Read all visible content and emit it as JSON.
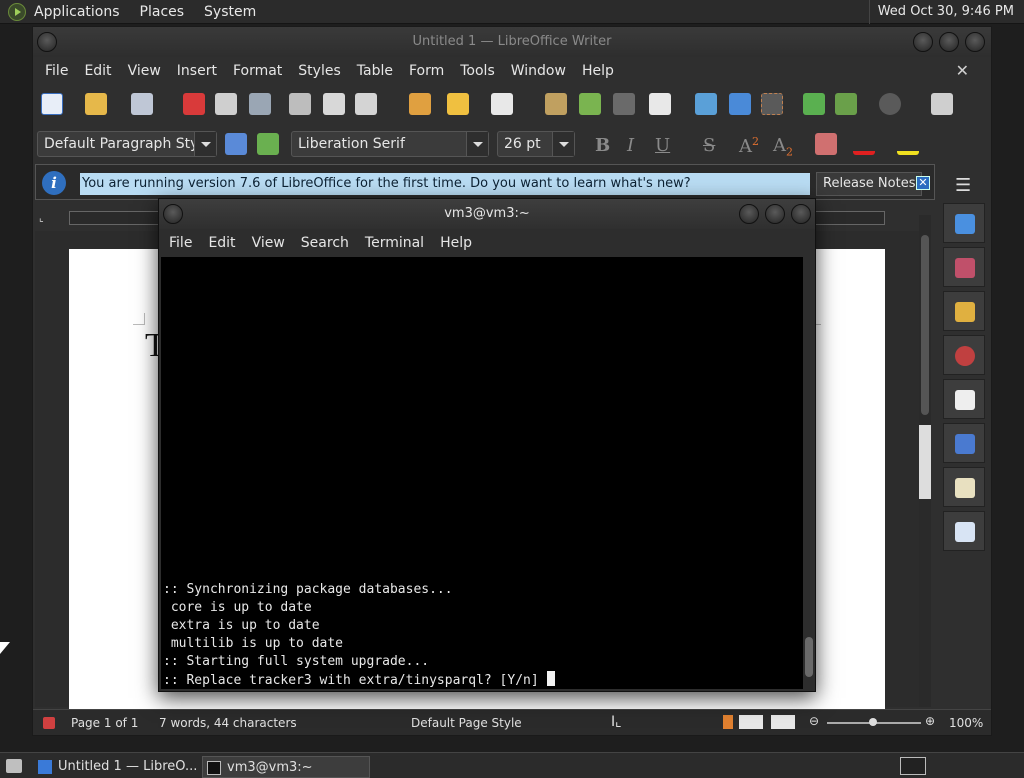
{
  "top_panel": {
    "menus": [
      "Applications",
      "Places",
      "System"
    ],
    "clock": "Wed Oct 30,  9:46 PM"
  },
  "writer": {
    "title": "Untitled 1 — LibreOffice Writer",
    "menu": [
      "File",
      "Edit",
      "View",
      "Insert",
      "Format",
      "Styles",
      "Table",
      "Form",
      "Tools",
      "Window",
      "Help"
    ],
    "paragraph_style": "Default Paragraph Style",
    "font_name": "Liberation Serif",
    "font_size": "26 pt",
    "infobar": {
      "message": "You are running version 7.6 of LibreOffice for the first time. Do you want to learn what's new?",
      "button": "Release Notes"
    },
    "document_text": "T",
    "statusbar": {
      "page": "Page 1 of 1",
      "words": "7 words, 44 characters",
      "page_style": "Default Page Style",
      "zoom": "100%"
    }
  },
  "terminal": {
    "title": "vm3@vm3:~",
    "menu": [
      "File",
      "Edit",
      "View",
      "Search",
      "Terminal",
      "Help"
    ],
    "lines": [
      ":: Synchronizing package databases...",
      " core is up to date",
      " extra is up to date",
      " multilib is up to date",
      ":: Starting full system upgrade...",
      ":: Replace tracker3 with extra/tinysparql? [Y/n] "
    ]
  },
  "taskbar": {
    "tasks": [
      "Untitled 1 — LibreO...",
      "vm3@vm3:~"
    ]
  },
  "colors": {
    "infobar_highlight": "#b9dcf3",
    "info_icon": "#2f6fbf",
    "terminal_bg": "#000000"
  }
}
